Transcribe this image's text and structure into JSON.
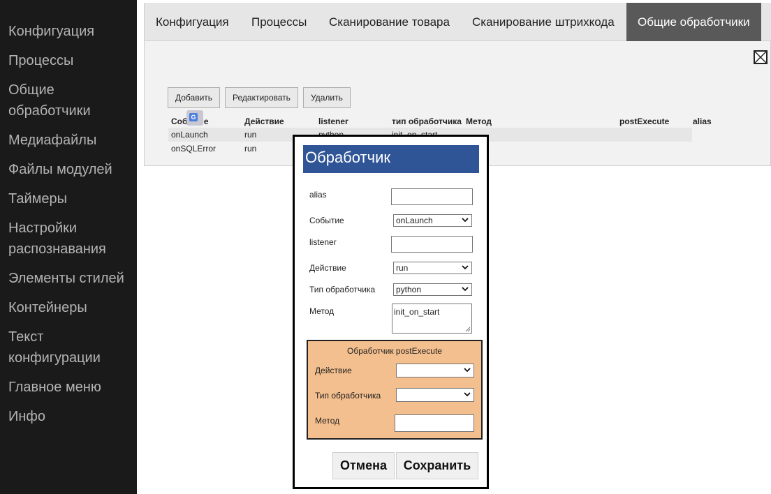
{
  "sidebar": {
    "items": [
      {
        "label": "Конфигуация"
      },
      {
        "label": "Процессы"
      },
      {
        "label": "Общие обработчики"
      },
      {
        "label": "Медиафайлы"
      },
      {
        "label": "Файлы модулей"
      },
      {
        "label": "Таймеры"
      },
      {
        "label": "Настройки распознавания"
      },
      {
        "label": "Элементы стилей"
      },
      {
        "label": "Контейнеры"
      },
      {
        "label": "Текст конфигурации"
      },
      {
        "label": "Главное меню"
      },
      {
        "label": "Инфо"
      }
    ]
  },
  "tabs": [
    {
      "label": "Конфигуация"
    },
    {
      "label": "Процессы"
    },
    {
      "label": "Сканирование товара"
    },
    {
      "label": "Сканирование штрихкода"
    },
    {
      "label": "Общие обработчики",
      "active": true
    }
  ],
  "toolbar": {
    "add_label": "Добавить",
    "edit_label": "Редактировать",
    "delete_label": "Удалить"
  },
  "table": {
    "headers": [
      "Событие",
      "Действие",
      "listener",
      "тип обработчика",
      "Метод",
      "postExecute",
      "alias"
    ],
    "rows": [
      {
        "event": "onLaunch",
        "action": "run",
        "listener": "python",
        "method": "init_on_start",
        "selected": true
      },
      {
        "event": "onSQLError",
        "action": "run"
      }
    ]
  },
  "modal": {
    "title": "Обработчик",
    "fields": {
      "alias_label": "alias",
      "alias_value": "",
      "event_label": "Событие",
      "event_value": "onLaunch",
      "listener_label": "listener",
      "listener_value": "",
      "action_label": "Действие",
      "action_value": "run",
      "handler_type_label": "Тип обработчика",
      "handler_type_value": "python",
      "method_label": "Метод",
      "method_value": "init_on_start"
    },
    "post_execute": {
      "title": "Обработчик postExecute",
      "action_label": "Действие",
      "handler_type_label": "Тип обработчика",
      "method_label": "Метод"
    },
    "cancel_label": "Отмена",
    "save_label": "Сохранить"
  },
  "colors": {
    "sidebar_bg": "#1a1a1a",
    "active_tab_bg": "#595959",
    "modal_title_bg": "#2f5597",
    "post_execute_bg": "#f4bf8e"
  }
}
